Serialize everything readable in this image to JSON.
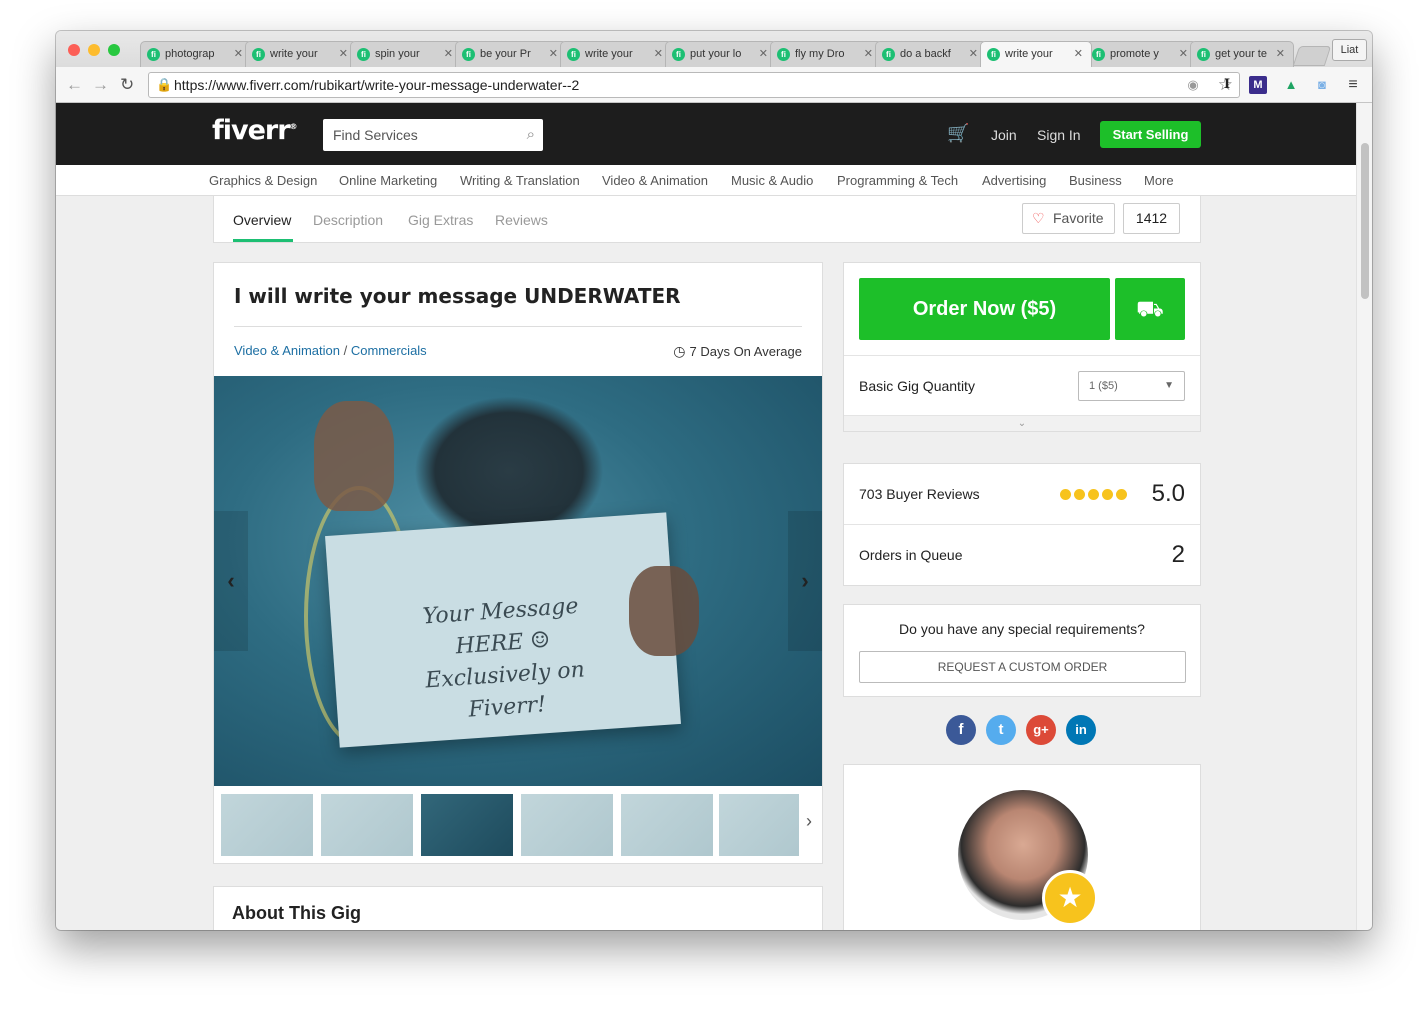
{
  "browser": {
    "tabs": [
      {
        "label": "photograp",
        "active": false
      },
      {
        "label": "write your",
        "active": false
      },
      {
        "label": "spin your",
        "active": false
      },
      {
        "label": "be your Pr",
        "active": false
      },
      {
        "label": "write your",
        "active": false
      },
      {
        "label": "put your lo",
        "active": false
      },
      {
        "label": "fly my Dro",
        "active": false
      },
      {
        "label": "do a backf",
        "active": false
      },
      {
        "label": "write your",
        "active": true
      },
      {
        "label": "promote y",
        "active": false
      },
      {
        "label": "get your te",
        "active": false
      }
    ],
    "profile_label": "Liat",
    "url": "https://www.fiverr.com/rubikart/write-your-message-underwater--2"
  },
  "header": {
    "logo": "fiverr",
    "logo_mark": "®",
    "search_placeholder": "Find Services",
    "join": "Join",
    "sign_in": "Sign In",
    "start_selling": "Start Selling"
  },
  "categories": [
    "Graphics & Design",
    "Online Marketing",
    "Writing & Translation",
    "Video & Animation",
    "Music & Audio",
    "Programming & Tech",
    "Advertising",
    "Business",
    "More"
  ],
  "gig_tabs": [
    "Overview",
    "Description",
    "Gig Extras",
    "Reviews"
  ],
  "favorite": {
    "label": "Favorite",
    "count": "1412"
  },
  "gig": {
    "title": "I will write your message UNDERWATER",
    "breadcrumb_category": "Video & Animation",
    "breadcrumb_sep": " / ",
    "breadcrumb_subcategory": "Commercials",
    "delivery": "7 Days On Average",
    "image_sign_text": "Your Message HERE ☺ Exclusively on Fiverr!",
    "about_heading": "About This Gig"
  },
  "order": {
    "order_now": "Order Now ($5)",
    "qty_label": "Basic Gig Quantity",
    "qty_value": "1 ($5)"
  },
  "stats": {
    "reviews_label": "703 Buyer Reviews",
    "rating": "5.0",
    "stars_filled": 5,
    "queue_label": "Orders in Queue",
    "queue_value": "2"
  },
  "custom_order": {
    "question": "Do you have any special requirements?",
    "button": "REQUEST A CUSTOM ORDER"
  },
  "social": {
    "facebook": "f",
    "twitter": "t",
    "googleplus": "g+",
    "linkedin": "in",
    "colors": {
      "facebook": "#3b5998",
      "twitter": "#55acee",
      "googleplus": "#dc4a38",
      "linkedin": "#0077b5"
    }
  },
  "colors": {
    "brand_green": "#1dbf29",
    "header_bg": "#1d1d1d",
    "link_blue": "#1d6fa3",
    "star_yellow": "#f7c31d"
  }
}
